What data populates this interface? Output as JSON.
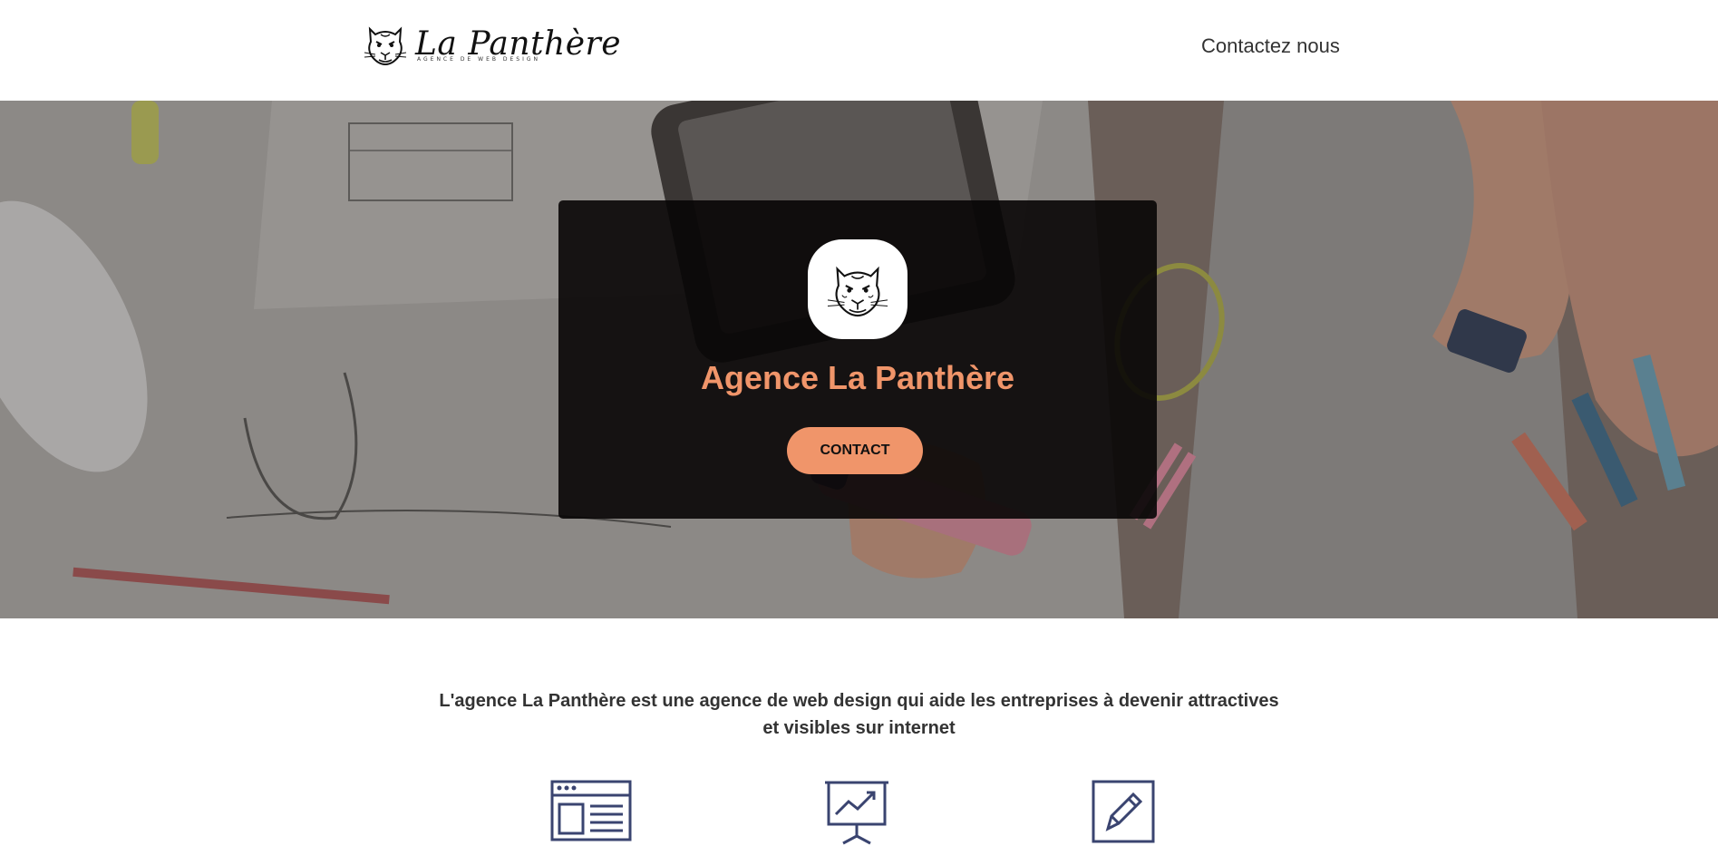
{
  "header": {
    "logo": {
      "title": "La Panthère",
      "subtitle": "AGENCE DE WEB DESIGN",
      "icon": "panther-icon"
    },
    "nav": {
      "contact_label": "Contactez nous"
    }
  },
  "hero": {
    "background": "designers-sketching-wireframes-photo",
    "title": "Agence La Panthère",
    "button_label": "CONTACT",
    "accent_color": "#f0956a"
  },
  "intro": {
    "line1": "L'agence La Panthère est une agence de web design qui aide les entreprises à devenir attractives",
    "line2": "et visibles sur internet"
  },
  "features": [
    {
      "icon": "web-layout-icon"
    },
    {
      "icon": "presentation-chart-icon"
    },
    {
      "icon": "edit-pencil-icon"
    }
  ],
  "colors": {
    "icon_stroke": "#3a4470",
    "text": "#333333"
  }
}
